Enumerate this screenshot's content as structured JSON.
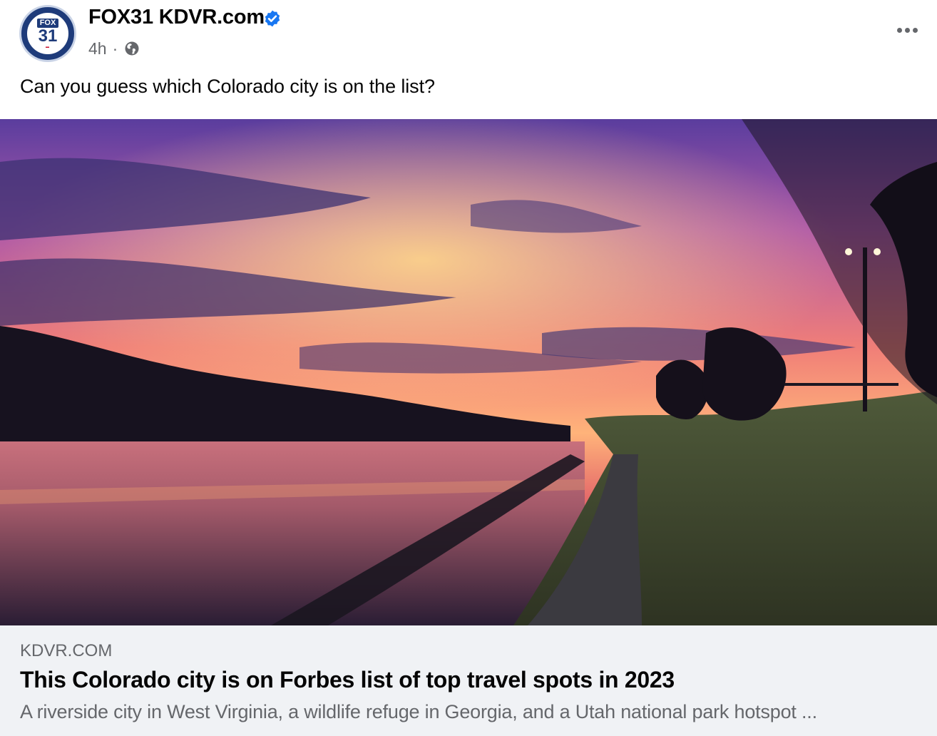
{
  "post": {
    "page_name": "FOX31 KDVR.com",
    "avatar": {
      "logo_top": "FOX",
      "logo_number": "31"
    },
    "timestamp": "4h",
    "separator": "·",
    "audience_icon": "globe-icon",
    "verified_icon": "verified-badge-icon",
    "more_icon": "more-options-icon",
    "text": "Can you guess which Colorado city is on the list?"
  },
  "link_preview": {
    "domain": "KDVR.COM",
    "title": "This Colorado city is on Forbes list of top travel spots in 2023",
    "description": "A riverside city in West Virginia, a wildlife refuge in Georgia, and a Utah national park hotspot ..."
  },
  "colors": {
    "verified_blue": "#1877f2",
    "secondary_text": "#65676b",
    "card_background": "#f0f2f5",
    "brand_navy": "#1e3b7a"
  }
}
